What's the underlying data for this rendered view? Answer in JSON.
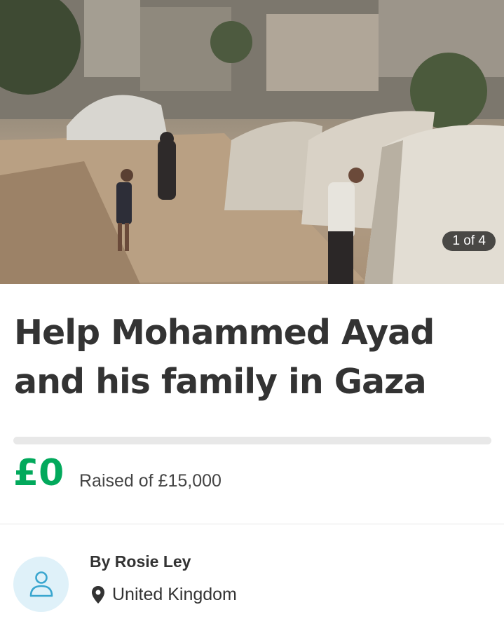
{
  "hero": {
    "image_description_icon": "photo-image",
    "counter": "1 of 4"
  },
  "campaign": {
    "title_line1": "Help Mohammed Ayad",
    "title_line2": "and his family in Gaza",
    "progress_fraction": 0,
    "amount": "£0",
    "raised_label": "Raised of £15,000"
  },
  "organizer": {
    "by_label": "By Rosie Ley",
    "location": "United Kingdom",
    "avatar_icon": "person-icon",
    "location_icon": "map-pin-icon"
  },
  "colors": {
    "accent_green": "#02a95c",
    "avatar_bg": "#dff1f9",
    "avatar_icon": "#3aa6cf",
    "text": "#333333"
  }
}
